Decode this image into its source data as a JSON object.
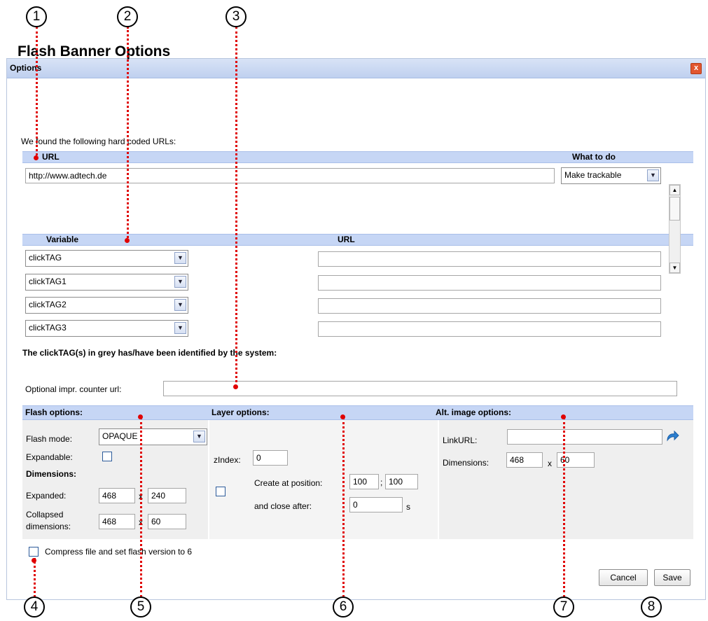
{
  "window": {
    "title": "Options",
    "close_glyph": "x"
  },
  "heading": "Flash Banner Options",
  "hardcoded": {
    "intro": "We found the following hard coded URLs:",
    "col_url": "URL",
    "col_action": "What to do",
    "url_value": "http://www.adtech.de",
    "action_value": "Make trackable"
  },
  "variables": {
    "col_variable": "Variable",
    "col_url": "URL",
    "rows": [
      {
        "variable": "clickTAG",
        "url": ""
      },
      {
        "variable": "clickTAG1",
        "url": ""
      },
      {
        "variable": "clickTAG2",
        "url": ""
      },
      {
        "variable": "clickTAG3",
        "url": ""
      }
    ],
    "note": "The clickTAG(s) in grey has/have been identified by the system:"
  },
  "impr_counter": {
    "label": "Optional impr. counter url:",
    "value": ""
  },
  "flash_options": {
    "title": "Flash options:",
    "mode_label": "Flash mode:",
    "mode_value": "OPAQUE",
    "expandable_label": "Expandable:",
    "dimensions_label": "Dimensions:",
    "expanded_label": "Expanded:",
    "expanded_w": "468",
    "expanded_h": "240",
    "collapsed_label_1": "Collapsed",
    "collapsed_label_2": "dimensions:",
    "collapsed_w": "468",
    "collapsed_h": "60",
    "x": "x"
  },
  "layer_options": {
    "title": "Layer options:",
    "zindex_label": "zIndex:",
    "zindex_value": "0",
    "create_label": "Create at position:",
    "pos_x": "100",
    "pos_sep": ";",
    "pos_y": "100",
    "close_label": "and close after:",
    "close_value": "0",
    "close_unit": "s"
  },
  "alt_image": {
    "title": "Alt. image options:",
    "link_label": "LinkURL:",
    "link_value": "",
    "dim_label": "Dimensions:",
    "w": "468",
    "x": "x",
    "h": "60"
  },
  "compress_label": "Compress file and set flash version to 6",
  "buttons": {
    "cancel": "Cancel",
    "save": "Save"
  },
  "callouts": [
    "1",
    "2",
    "3",
    "4",
    "5",
    "6",
    "7",
    "8"
  ],
  "colors": {
    "band": "#c6d6f5",
    "callout_line": "#e00000",
    "close": "#e2562f"
  }
}
